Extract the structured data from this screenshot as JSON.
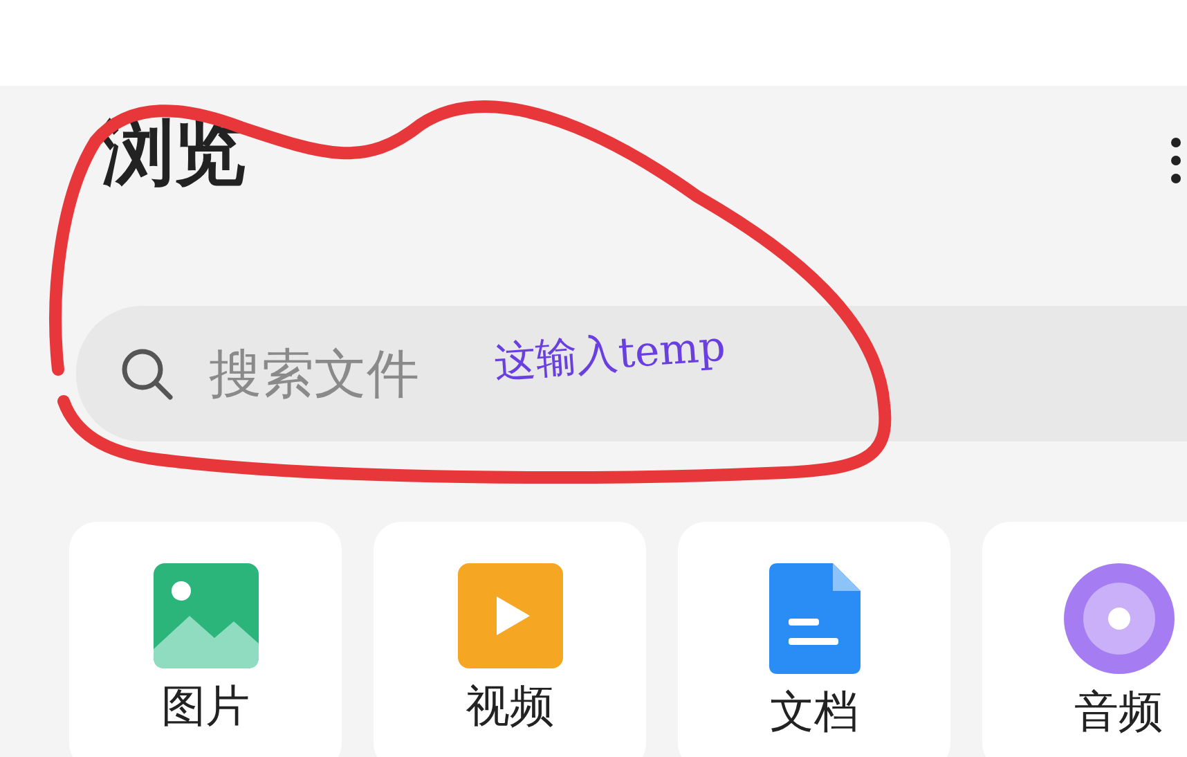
{
  "title": "浏览",
  "search": {
    "placeholder": "搜索文件"
  },
  "annotation": {
    "text": "这输入temp"
  },
  "categories": [
    {
      "label": "图片",
      "kind": "image"
    },
    {
      "label": "视频",
      "kind": "video"
    },
    {
      "label": "文档",
      "kind": "document"
    },
    {
      "label": "音频",
      "kind": "audio"
    }
  ]
}
